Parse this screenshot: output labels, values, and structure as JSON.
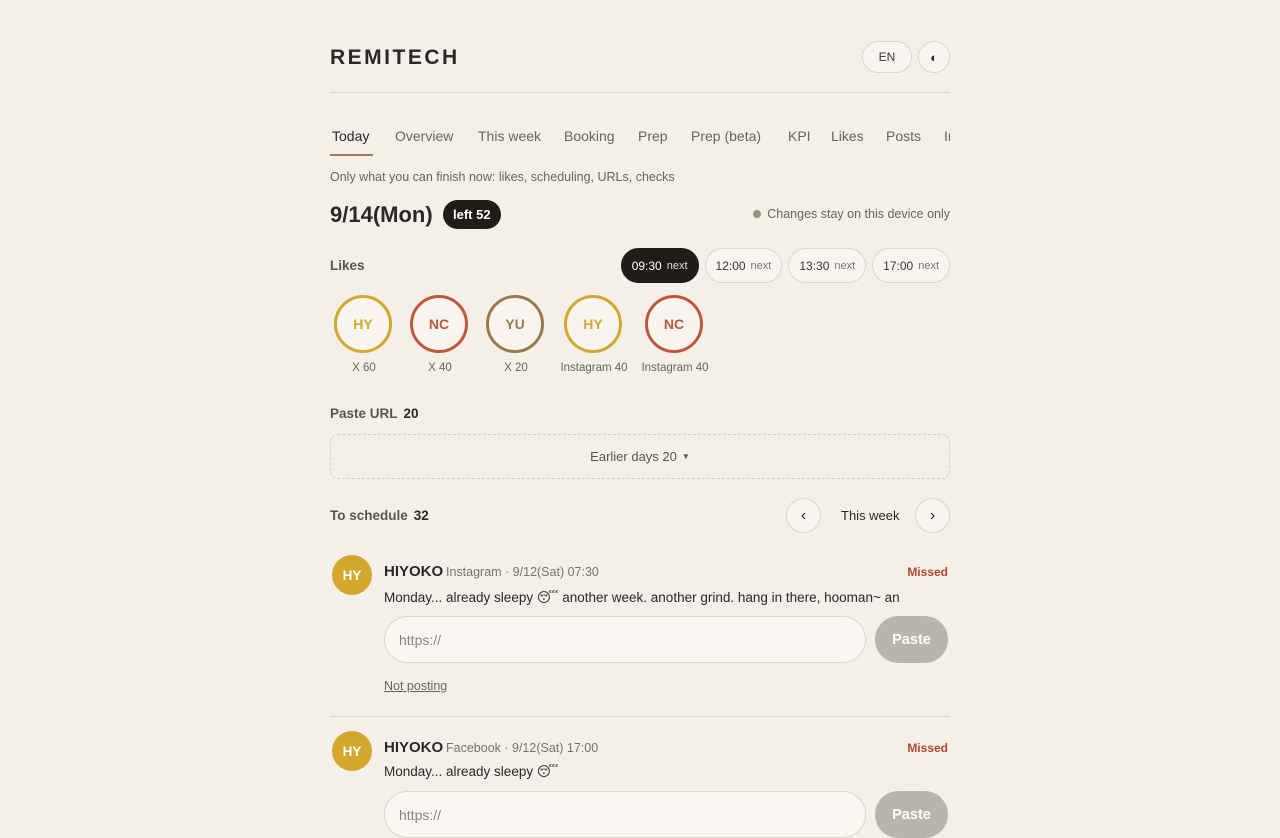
{
  "header": {
    "brand": "REMITECH",
    "lang": "EN",
    "theme_icon": "contrast-icon"
  },
  "tabs": [
    {
      "label": "Today",
      "active": true
    },
    {
      "label": "Overview"
    },
    {
      "label": "This week"
    },
    {
      "label": "Booking"
    },
    {
      "label": "Prep"
    },
    {
      "label": "Prep (beta)"
    },
    {
      "label": "KPI"
    },
    {
      "label": "Likes"
    },
    {
      "label": "Posts"
    },
    {
      "label": "In"
    }
  ],
  "today": {
    "subtitle": "Only what you can finish now: likes, scheduling, URLs, checks",
    "date": "9/14(Mon)",
    "left_badge": "left 52",
    "device_note": "Changes stay on this device only"
  },
  "likes": {
    "label": "Likes",
    "times": [
      {
        "time": "09:30",
        "tag": "next",
        "active": true
      },
      {
        "time": "12:00",
        "tag": "next"
      },
      {
        "time": "13:30",
        "tag": "next"
      },
      {
        "time": "17:00",
        "tag": "next"
      }
    ],
    "accounts": [
      {
        "initials": "HY",
        "caption": "X 60",
        "color": "#d4a82c"
      },
      {
        "initials": "NC",
        "caption": "X 40",
        "color": "#c0573a"
      },
      {
        "initials": "YU",
        "caption": "X 20",
        "color": "#9a7a4c"
      },
      {
        "initials": "HY",
        "caption": "Instagram 40",
        "color": "#d4a82c"
      },
      {
        "initials": "NC",
        "caption": "Instagram 40",
        "color": "#c0573a"
      }
    ]
  },
  "paste_url": {
    "label": "Paste URL",
    "count": "20",
    "earlier": "Earlier days 20",
    "caret": "▼"
  },
  "schedule": {
    "label": "To schedule",
    "count": "32",
    "prev": "‹",
    "week": "This week",
    "next": "›"
  },
  "posts": [
    {
      "initials": "HY",
      "name": "HIYOKO",
      "meta": "Instagram · 9/12(Sat) 07:30",
      "status": "Missed",
      "text": "Monday... already sleepy 😴 another week. another grind. hang in there, hooman~ an",
      "placeholder": "https://",
      "paste": "Paste",
      "not_posting": "Not posting"
    },
    {
      "initials": "HY",
      "name": "HIYOKO",
      "meta": "Facebook · 9/12(Sat) 17:00",
      "status": "Missed",
      "text": "Monday... already sleepy 😴",
      "placeholder": "https://",
      "paste": "Paste"
    }
  ]
}
